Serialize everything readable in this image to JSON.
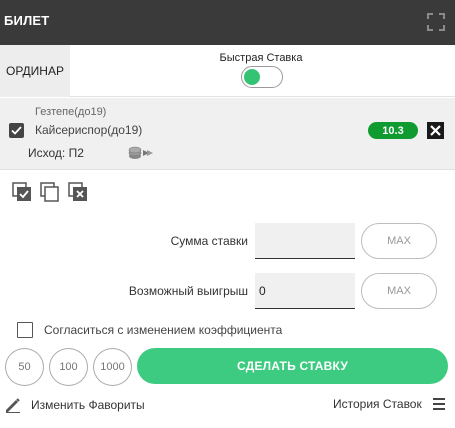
{
  "header": {
    "title": "БИЛЕТ",
    "expand_icon": "expand-icon"
  },
  "tabs": {
    "single": "ОРДИНАР"
  },
  "quick_bet": {
    "label": "Быстрая Ставка",
    "enabled": true
  },
  "bet": {
    "team1": "Гезтепе(до19)",
    "team2": "Кайсериспор(до19)",
    "outcome": "Исход: П2",
    "odds": "10.3",
    "checked": true
  },
  "stake": {
    "label": "Сумма ставки",
    "value": "",
    "max_label": "MAX"
  },
  "payout": {
    "label": "Возможный выигрыш",
    "value": "0",
    "max_label": "MAX"
  },
  "agree": {
    "label": "Согласиться с изменением коэффициента",
    "checked": false
  },
  "quick_amounts": [
    "50",
    "100",
    "1000"
  ],
  "place_bet_label": "СДЕЛАТЬ СТАВКУ",
  "footer": {
    "edit_favorites": "Изменить Фавориты",
    "history": "История Ставок"
  },
  "colors": {
    "header_bg": "#3a3a3a",
    "accent_green": "#3ccb80",
    "odds_green": "#0f9b2f"
  }
}
